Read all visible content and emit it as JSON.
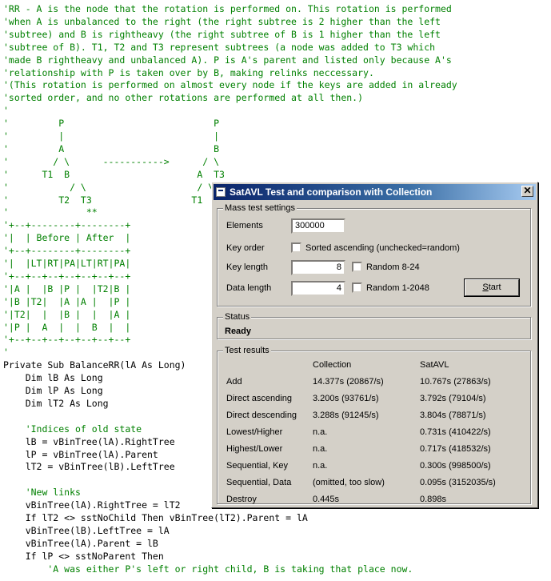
{
  "code": {
    "lines": [
      {
        "text": "'RR - A is the node that the rotation is performed on. This rotation is performed",
        "kind": "comment"
      },
      {
        "text": "'when A is unbalanced to the right (the right subtree is 2 higher than the left",
        "kind": "comment"
      },
      {
        "text": "'subtree) and B is rightheavy (the right subtree of B is 1 higher than the left",
        "kind": "comment"
      },
      {
        "text": "'subtree of B). T1, T2 and T3 represent subtrees (a node was added to T3 which",
        "kind": "comment"
      },
      {
        "text": "'made B rightheavy and unbalanced A). P is A's parent and listed only because A's",
        "kind": "comment"
      },
      {
        "text": "'relationship with P is taken over by B, making relinks neccessary.",
        "kind": "comment"
      },
      {
        "text": "'(This rotation is performed on almost every node if the keys are added in already",
        "kind": "comment"
      },
      {
        "text": "'sorted order, and no other rotations are performed at all then.)",
        "kind": "comment"
      },
      {
        "text": "'",
        "kind": "comment"
      },
      {
        "text": "'         P                           P",
        "kind": "comment"
      },
      {
        "text": "'         |                           |",
        "kind": "comment"
      },
      {
        "text": "'         A                           B",
        "kind": "comment"
      },
      {
        "text": "'        / \\      ----------->      / \\",
        "kind": "comment"
      },
      {
        "text": "'      T1  B                       A  T3",
        "kind": "comment"
      },
      {
        "text": "'           / \\                    / \\",
        "kind": "comment"
      },
      {
        "text": "'         T2  T3                  T1  T2",
        "kind": "comment"
      },
      {
        "text": "'              **",
        "kind": "comment"
      },
      {
        "text": "'+--+--------+--------+",
        "kind": "comment"
      },
      {
        "text": "'|  | Before | After  |",
        "kind": "comment"
      },
      {
        "text": "'+--+--------+--------+",
        "kind": "comment"
      },
      {
        "text": "'|  |LT|RT|PA|LT|RT|PA|",
        "kind": "comment"
      },
      {
        "text": "'+--+--+--+--+--+--+--+",
        "kind": "comment"
      },
      {
        "text": "'|A |  |B |P |  |T2|B |",
        "kind": "comment"
      },
      {
        "text": "'|B |T2|  |A |A |  |P |",
        "kind": "comment"
      },
      {
        "text": "'|T2|  |  |B |  |  |A |",
        "kind": "comment"
      },
      {
        "text": "'|P |  A  |  |  B  |  |",
        "kind": "comment"
      },
      {
        "text": "'+--+--+--+--+--+--+--+",
        "kind": "comment"
      },
      {
        "text": "'",
        "kind": "comment"
      },
      {
        "text": "Private Sub BalanceRR(lA As Long)",
        "kind": "code"
      },
      {
        "text": "    Dim lB As Long",
        "kind": "code"
      },
      {
        "text": "    Dim lP As Long",
        "kind": "code"
      },
      {
        "text": "    Dim lT2 As Long",
        "kind": "code"
      },
      {
        "text": "",
        "kind": "code"
      },
      {
        "text": "    'Indices of old state",
        "kind": "comment"
      },
      {
        "text": "    lB = vBinTree(lA).RightTree",
        "kind": "code"
      },
      {
        "text": "    lP = vBinTree(lA).Parent",
        "kind": "code"
      },
      {
        "text": "    lT2 = vBinTree(lB).LeftTree",
        "kind": "code"
      },
      {
        "text": "",
        "kind": "code"
      },
      {
        "text": "    'New links",
        "kind": "comment"
      },
      {
        "text": "    vBinTree(lA).RightTree = lT2",
        "kind": "code"
      },
      {
        "text": "    If lT2 <> sstNoChild Then vBinTree(lT2).Parent = lA",
        "kind": "code"
      },
      {
        "text": "    vBinTree(lB).LeftTree = lA",
        "kind": "code"
      },
      {
        "text": "    vBinTree(lA).Parent = lB",
        "kind": "code"
      },
      {
        "text": "    If lP <> sstNoParent Then",
        "kind": "code"
      },
      {
        "text": "        'A was either P's left or right child, B is taking that place now.",
        "kind": "comment"
      }
    ]
  },
  "dialog": {
    "title": "SatAVL Test and comparison with Collection",
    "close_glyph": "✕",
    "mass_test": {
      "group_title": "Mass test settings",
      "elements_label": "Elements",
      "elements_value": "300000",
      "key_order_label": "Key order",
      "sorted_checkbox_label": "Sorted ascending (unchecked=random)",
      "sorted_checked": false,
      "key_length_label": "Key length",
      "key_length_value": "8",
      "random_key_label": "Random 8-24",
      "random_key_checked": false,
      "data_length_label": "Data length",
      "data_length_value": "4",
      "random_data_label": "Random 1-2048",
      "random_data_checked": false,
      "start_label_first": "S",
      "start_label_rest": "tart"
    },
    "status": {
      "group_title": "Status",
      "value": "Ready"
    },
    "results": {
      "group_title": "Test results",
      "col_collection": "Collection",
      "col_satavl": "SatAVL",
      "rows": [
        {
          "label": "Add",
          "collection": "14.377s (20867/s)",
          "satavl": "10.767s (27863/s)"
        },
        {
          "label": "Direct ascending",
          "collection": "3.200s (93761/s)",
          "satavl": "3.792s (79104/s)"
        },
        {
          "label": "Direct descending",
          "collection": "3.288s (91245/s)",
          "satavl": "3.804s (78871/s)"
        },
        {
          "label": "Lowest/Higher",
          "collection": "n.a.",
          "satavl": "0.731s (410422/s)"
        },
        {
          "label": "Highest/Lower",
          "collection": "n.a.",
          "satavl": "0.717s (418532/s)"
        },
        {
          "label": "Sequential, Key",
          "collection": "n.a.",
          "satavl": "0.300s (998500/s)"
        },
        {
          "label": "Sequential, Data",
          "collection": "(omitted, too slow)",
          "satavl": "0.095s (3152035/s)"
        },
        {
          "label": "Destroy",
          "collection": "0.445s",
          "satavl": "0.898s"
        }
      ]
    }
  }
}
